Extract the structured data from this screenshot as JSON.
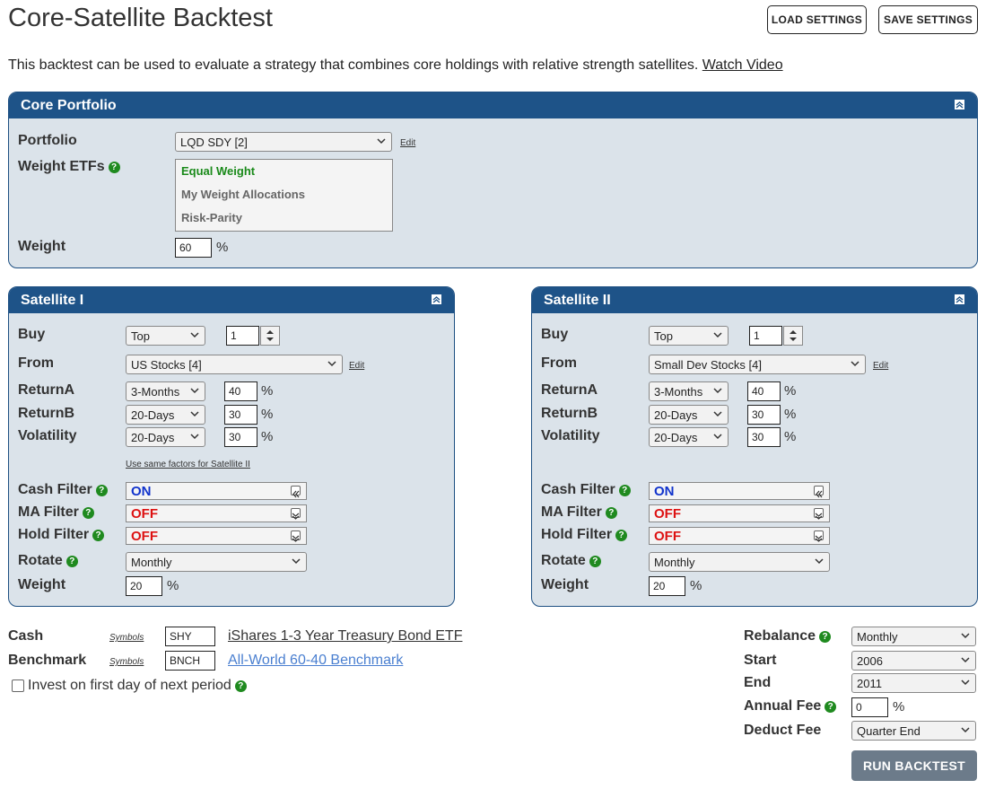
{
  "page": {
    "title": "Core-Satellite Backtest",
    "description": "This backtest can be used to evaluate a strategy that combines core holdings with relative strength satellites.",
    "watch_video": "Watch Video",
    "load_settings": "LOAD SETTINGS",
    "save_settings": "SAVE SETTINGS"
  },
  "core": {
    "header": "Core Portfolio",
    "portfolio_label": "Portfolio",
    "portfolio_value": "LQD SDY [2]",
    "edit": "Edit",
    "weight_etfs_label": "Weight ETFs",
    "weight_options": [
      "Equal Weight",
      "My Weight Allocations",
      "Risk-Parity"
    ],
    "weight_selected": "Equal Weight",
    "weight_label": "Weight",
    "weight_value": "60",
    "pct": "%"
  },
  "sat1": {
    "header": "Satellite I",
    "buy_label": "Buy",
    "buy_mode": "Top",
    "buy_count": "1",
    "from_label": "From",
    "from_value": "US Stocks [4]",
    "edit": "Edit",
    "returnA_label": "ReturnA",
    "returnA_period": "3-Months",
    "returnA_value": "40",
    "returnB_label": "ReturnB",
    "returnB_period": "20-Days",
    "returnB_value": "30",
    "vol_label": "Volatility",
    "vol_period": "20-Days",
    "vol_value": "30",
    "same_factors": "Use same factors for Satellite II",
    "cash_label": "Cash Filter",
    "cash_value": "ON",
    "ma_label": "MA Filter",
    "ma_value": "OFF",
    "hold_label": "Hold Filter",
    "hold_value": "OFF",
    "rotate_label": "Rotate",
    "rotate_value": "Monthly",
    "weight_label": "Weight",
    "weight_value": "20",
    "pct": "%"
  },
  "sat2": {
    "header": "Satellite II",
    "buy_label": "Buy",
    "buy_mode": "Top",
    "buy_count": "1",
    "from_label": "From",
    "from_value": "Small Dev Stocks [4]",
    "edit": "Edit",
    "returnA_label": "ReturnA",
    "returnA_period": "3-Months",
    "returnA_value": "40",
    "returnB_label": "ReturnB",
    "returnB_period": "20-Days",
    "returnB_value": "30",
    "vol_label": "Volatility",
    "vol_period": "20-Days",
    "vol_value": "30",
    "cash_label": "Cash Filter",
    "cash_value": "ON",
    "ma_label": "MA Filter",
    "ma_value": "OFF",
    "hold_label": "Hold Filter",
    "hold_value": "OFF",
    "rotate_label": "Rotate",
    "rotate_value": "Monthly",
    "weight_label": "Weight",
    "weight_value": "20",
    "pct": "%"
  },
  "bottom": {
    "cash_label": "Cash",
    "symbols": "Symbols",
    "cash_symbol": "SHY",
    "cash_name": "iShares 1-3 Year Treasury Bond ETF",
    "bench_label": "Benchmark",
    "bench_symbol": "BNCH",
    "bench_name": "All-World 60-40 Benchmark",
    "invest_first_day": "Invest on first day of next period",
    "rebalance_label": "Rebalance",
    "rebalance_value": "Monthly",
    "start_label": "Start",
    "start_value": "2006",
    "end_label": "End",
    "end_value": "2011",
    "fee_label": "Annual Fee",
    "fee_value": "0",
    "pct": "%",
    "deduct_label": "Deduct Fee",
    "deduct_value": "Quarter End",
    "run": "RUN BACKTEST"
  },
  "colors": {
    "panel_header": "#1e5388",
    "panel_bg": "#dbe3ea",
    "help": "#1f8a1f",
    "on": "#1133cc",
    "off": "#dd1111",
    "link_blue": "#4a7fd0",
    "run_button": "#6c7b8a"
  }
}
